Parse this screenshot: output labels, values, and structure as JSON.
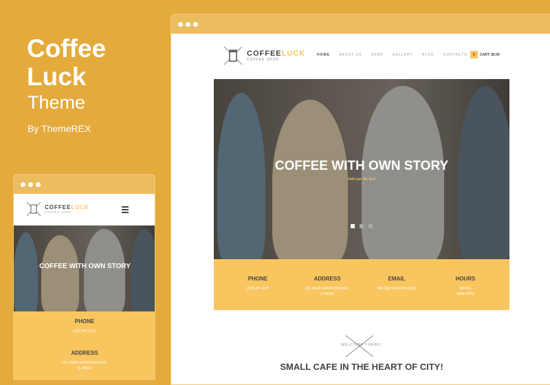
{
  "promo": {
    "title_line1": "Coffee",
    "title_line2": "Luck",
    "subtitle": "Theme",
    "byline": "By ThemeREX"
  },
  "site": {
    "logo_name_a": "COFFEE",
    "logo_name_b": "LUCK",
    "logo_tag": "COFFEE SHOP",
    "nav": [
      "HOME",
      "ABOUT US",
      "SHOP",
      "GALLERY",
      "BLOG",
      "CONTACTS"
    ],
    "cart_count": "0",
    "cart_label": "CART: $0.00",
    "hero_title": "COFFEE WITH OWN STORY",
    "hero_sub": "visit our the best",
    "slider_active": 1,
    "slider_count": 3,
    "info": [
      {
        "label": "PHONE",
        "value": "(323) 467-1175",
        "value2": ""
      },
      {
        "label": "ADDRESS",
        "value": "123, NEW LENOXCHICAGO,",
        "value2": "IL 60606"
      },
      {
        "label": "EMAIL",
        "value": "INFO@YOURSITE.COM",
        "value2": ""
      },
      {
        "label": "HOURS",
        "value": "MO-SU",
        "value2": "8AM-10PM"
      }
    ],
    "welcome": "WELCOME THERE!",
    "section_title": "SMALL CAFE IN THE HEART OF CITY!"
  },
  "colors": {
    "background": "#e4aa3b",
    "accent": "#f9c55f"
  }
}
